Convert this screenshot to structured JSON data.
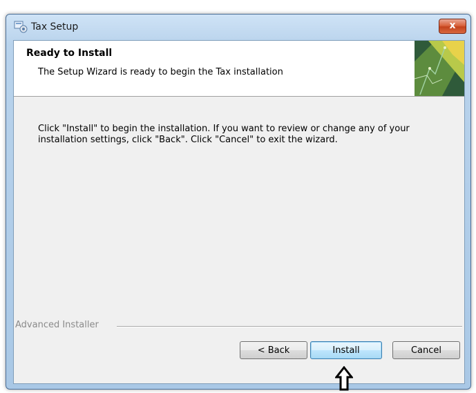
{
  "window": {
    "title": "Tax Setup",
    "close_label": "x"
  },
  "banner": {
    "title": "Ready to Install",
    "subtitle": "The Setup Wizard is ready to begin the Tax installation"
  },
  "body": {
    "message": "Click \"Install\" to begin the installation.  If you want to review or change any of your installation settings, click \"Back\".  Click \"Cancel\" to exit the wizard."
  },
  "footer": {
    "branding": "Advanced Installer"
  },
  "buttons": {
    "back": "< Back",
    "install": "Install",
    "cancel": "Cancel"
  },
  "icons": {
    "app": "setup-icon",
    "banner": "banner-graphic-icon",
    "annotation": "up-arrow-icon"
  },
  "colors": {
    "title_bar": "#b9d3ec",
    "close_button": "#c3431c",
    "install_focus": "#bee6fd"
  }
}
